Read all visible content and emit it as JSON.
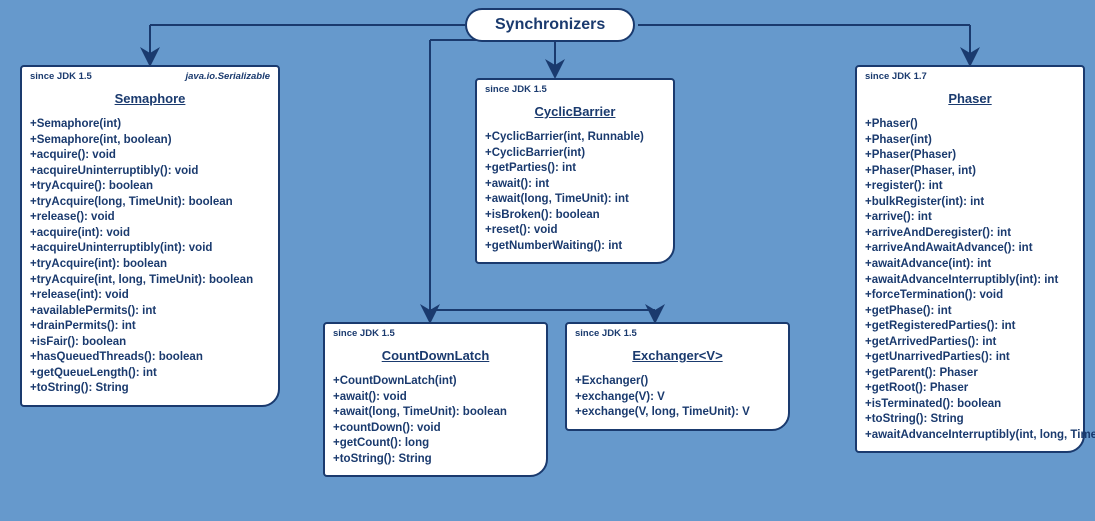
{
  "root": {
    "title": "Synchronizers"
  },
  "semaphore": {
    "since": "since JDK 1.5",
    "iface": "java.io.Serializable",
    "name": "Semaphore",
    "methods": [
      "+Semaphore(int)",
      "+Semaphore(int, boolean)",
      "+acquire(): void",
      "+acquireUninterruptibly(): void",
      "+tryAcquire(): boolean",
      "+tryAcquire(long, TimeUnit): boolean",
      "+release(): void",
      "+acquire(int): void",
      "+acquireUninterruptibly(int): void",
      "+tryAcquire(int): boolean",
      "+tryAcquire(int, long, TimeUnit): boolean",
      "+release(int): void",
      "+availablePermits(): int",
      "+drainPermits(): int",
      "+isFair(): boolean",
      "+hasQueuedThreads(): boolean",
      "+getQueueLength(): int",
      "+toString(): String"
    ]
  },
  "cyclicbarrier": {
    "since": "since JDK 1.5",
    "name": "CyclicBarrier",
    "methods": [
      "+CyclicBarrier(int, Runnable)",
      "+CyclicBarrier(int)",
      "+getParties(): int",
      "+await(): int",
      "+await(long, TimeUnit): int",
      "+isBroken(): boolean",
      "+reset(): void",
      "+getNumberWaiting(): int"
    ]
  },
  "countdownlatch": {
    "since": "since JDK 1.5",
    "name": "CountDownLatch",
    "methods": [
      "+CountDownLatch(int)",
      "+await(): void",
      "+await(long, TimeUnit): boolean",
      "+countDown(): void",
      "+getCount(): long",
      "+toString(): String"
    ]
  },
  "exchanger": {
    "since": "since JDK 1.5",
    "name": "Exchanger<V>",
    "methods": [
      "+Exchanger()",
      "+exchange(V): V",
      "+exchange(V, long, TimeUnit): V"
    ]
  },
  "phaser": {
    "since": "since JDK 1.7",
    "name": "Phaser",
    "methods": [
      "+Phaser()",
      "+Phaser(int)",
      "+Phaser(Phaser)",
      "+Phaser(Phaser, int)",
      "+register(): int",
      "+bulkRegister(int): int",
      "+arrive(): int",
      "+arriveAndDeregister(): int",
      "+arriveAndAwaitAdvance(): int",
      "+awaitAdvance(int): int",
      "+awaitAdvanceInterruptibly(int): int",
      "+forceTermination(): void",
      "+getPhase(): int",
      "+getRegisteredParties(): int",
      "+getArrivedParties(): int",
      "+getUnarrivedParties(): int",
      "+getParent(): Phaser",
      "+getRoot(): Phaser",
      "+isTerminated(): boolean",
      "+toString(): String",
      "+awaitAdvanceInterruptibly(int, long, TimeUnit): int"
    ]
  }
}
